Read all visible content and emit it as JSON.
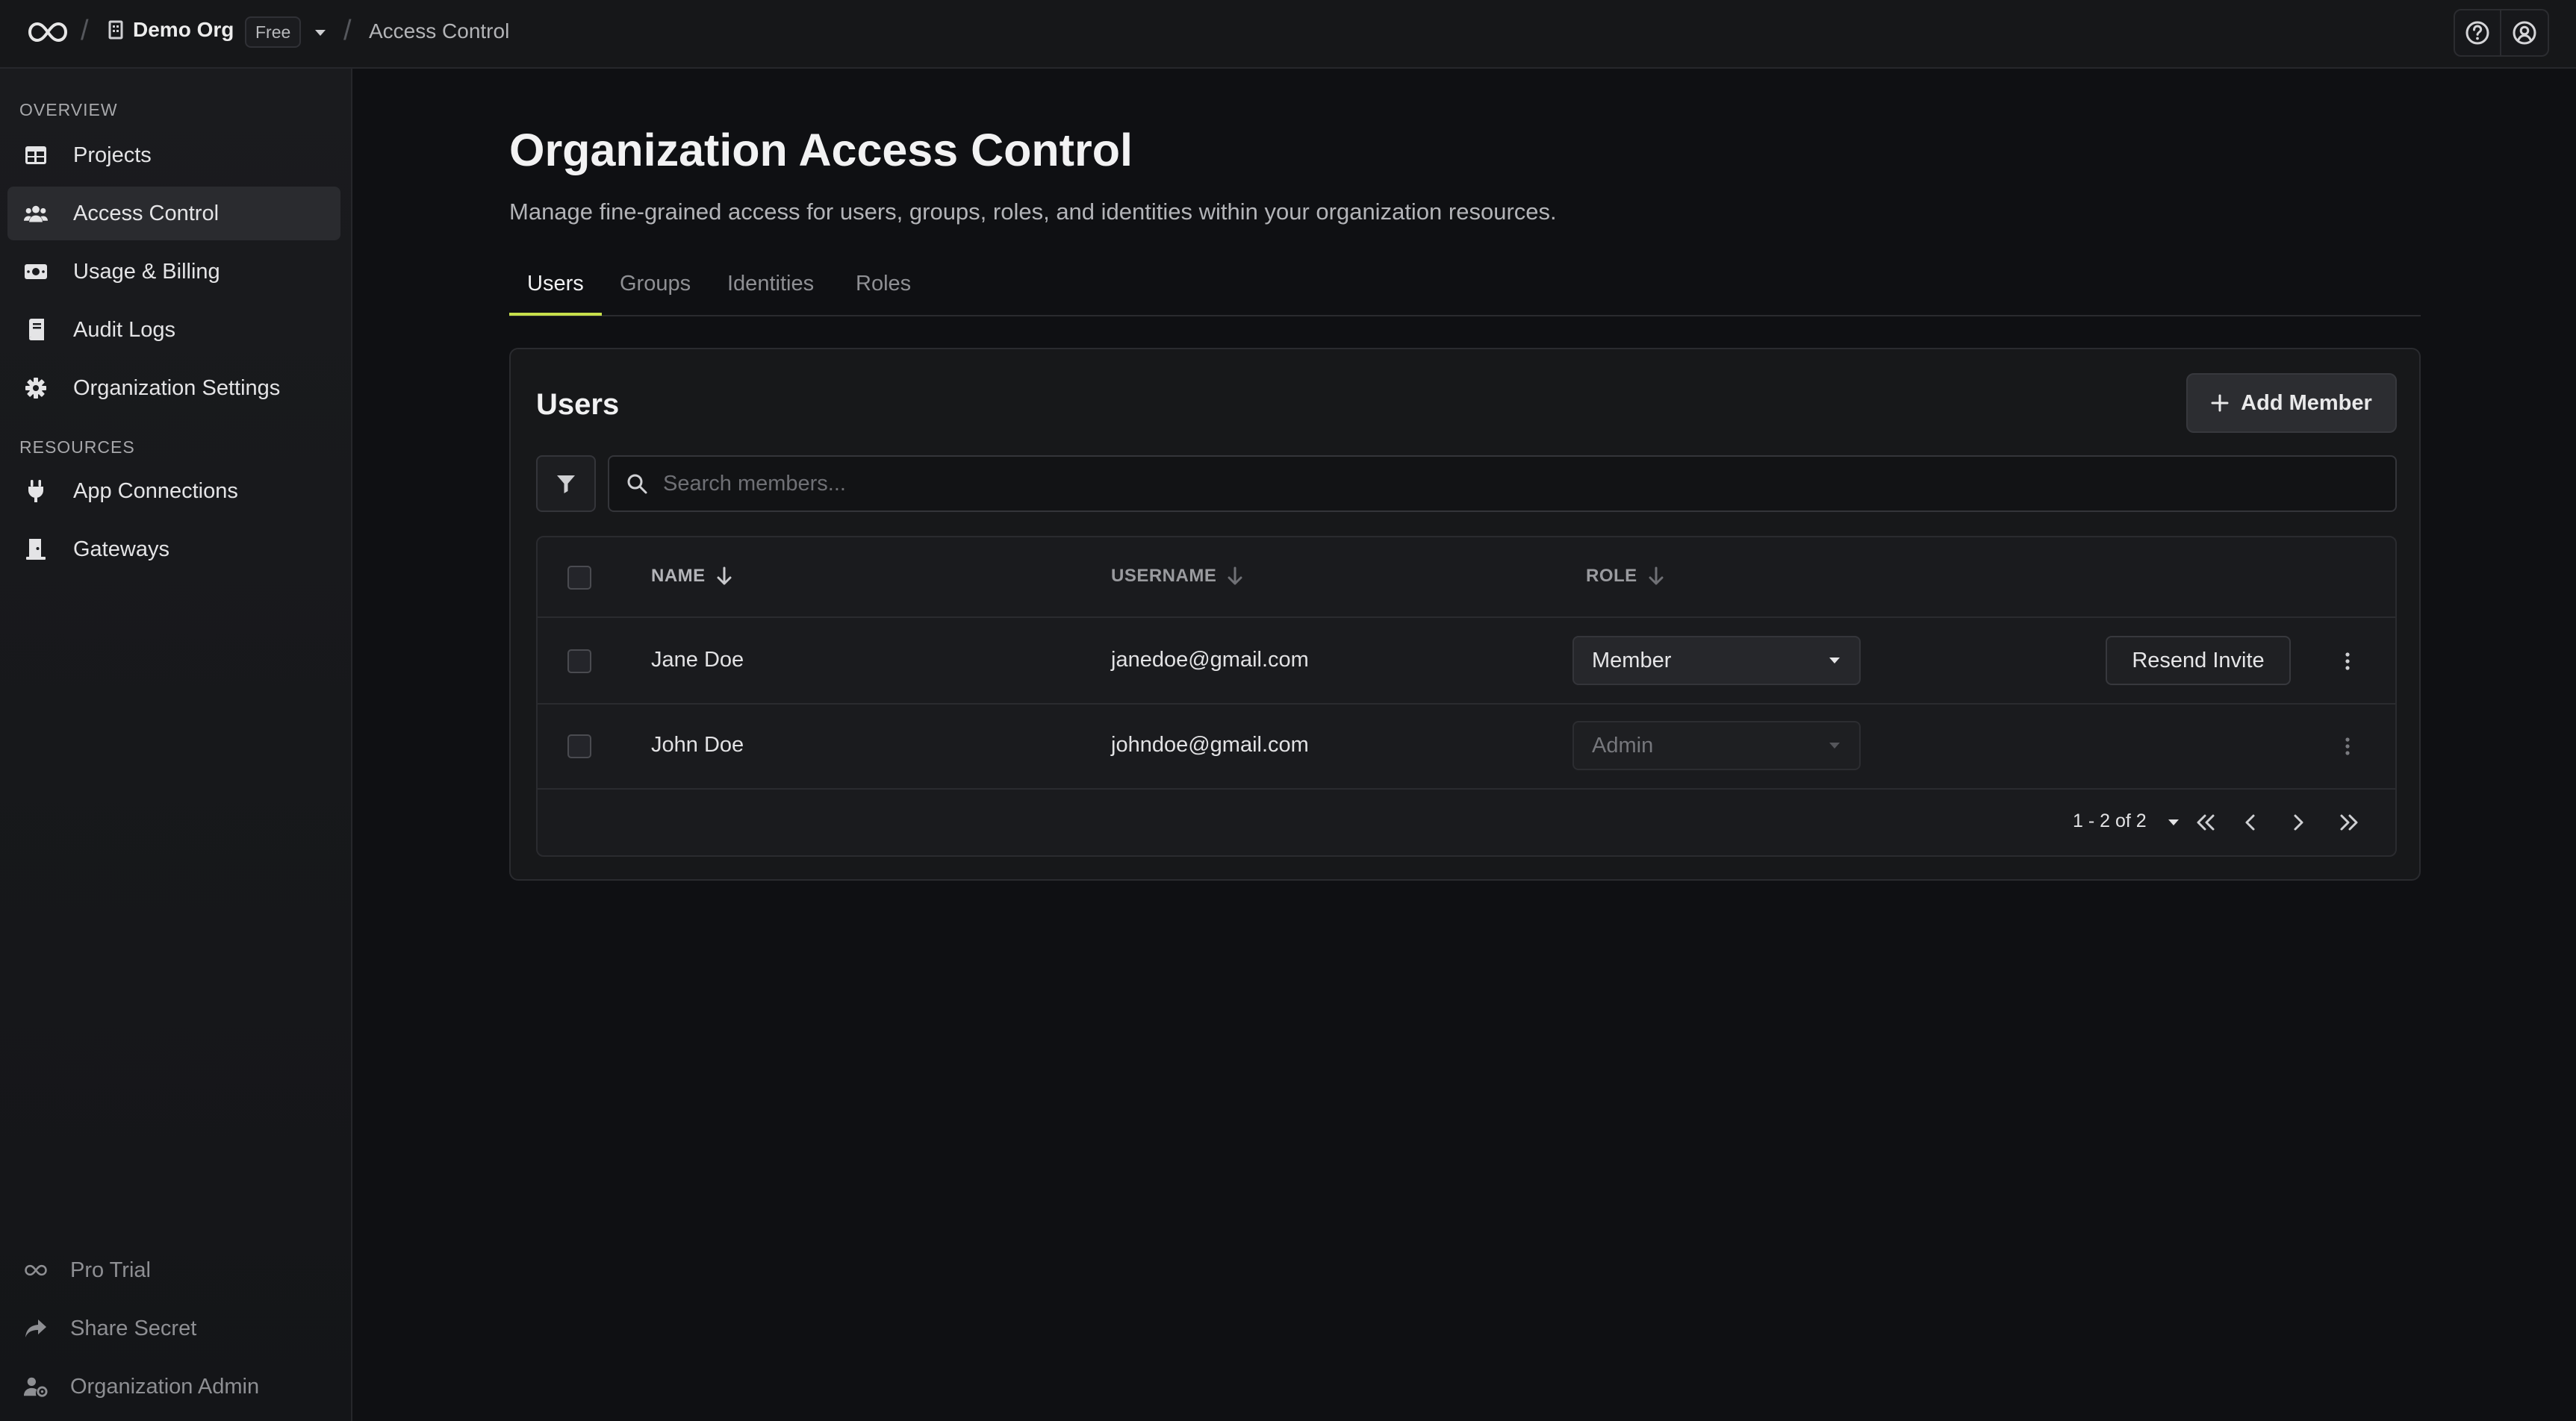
{
  "topbar": {
    "org_name": "Demo Org",
    "plan_badge": "Free",
    "current_page": "Access Control",
    "separator": "/"
  },
  "sidebar": {
    "overview_label": "OVERVIEW",
    "resources_label": "RESOURCES",
    "items": [
      {
        "label": "Projects",
        "icon": "table-icon"
      },
      {
        "label": "Access Control",
        "icon": "users-icon",
        "active": true
      },
      {
        "label": "Usage & Billing",
        "icon": "money-icon"
      },
      {
        "label": "Audit Logs",
        "icon": "book-icon"
      },
      {
        "label": "Organization Settings",
        "icon": "gear-icon"
      }
    ],
    "resources": [
      {
        "label": "App Connections",
        "icon": "plug-icon"
      },
      {
        "label": "Gateways",
        "icon": "gateway-icon"
      }
    ],
    "footer": [
      {
        "label": "Pro Trial",
        "icon": "infinity-icon"
      },
      {
        "label": "Share Secret",
        "icon": "share-icon"
      },
      {
        "label": "Organization Admin",
        "icon": "user-gear-icon"
      }
    ]
  },
  "main": {
    "title": "Organization Access Control",
    "subtitle": "Manage fine-grained access for users, groups, roles, and identities within your organization resources.",
    "tabs": [
      {
        "label": "Users",
        "active": true
      },
      {
        "label": "Groups"
      },
      {
        "label": "Identities"
      },
      {
        "label": "Roles"
      }
    ]
  },
  "users_card": {
    "title": "Users",
    "add_button": "Add Member",
    "search_placeholder": "Search members...",
    "columns": {
      "name": "NAME",
      "username": "USERNAME",
      "role": "ROLE"
    },
    "rows": [
      {
        "name": "Jane Doe",
        "username": "janedoe@gmail.com",
        "role": "Member",
        "action": "Resend Invite"
      },
      {
        "name": "John Doe",
        "username": "johndoe@gmail.com",
        "role": "Admin",
        "action": ""
      }
    ],
    "pagination": "1 - 2 of 2"
  },
  "colors": {
    "accent": "#c7e04b",
    "background": "#0f1013",
    "surface": "#17181a"
  }
}
